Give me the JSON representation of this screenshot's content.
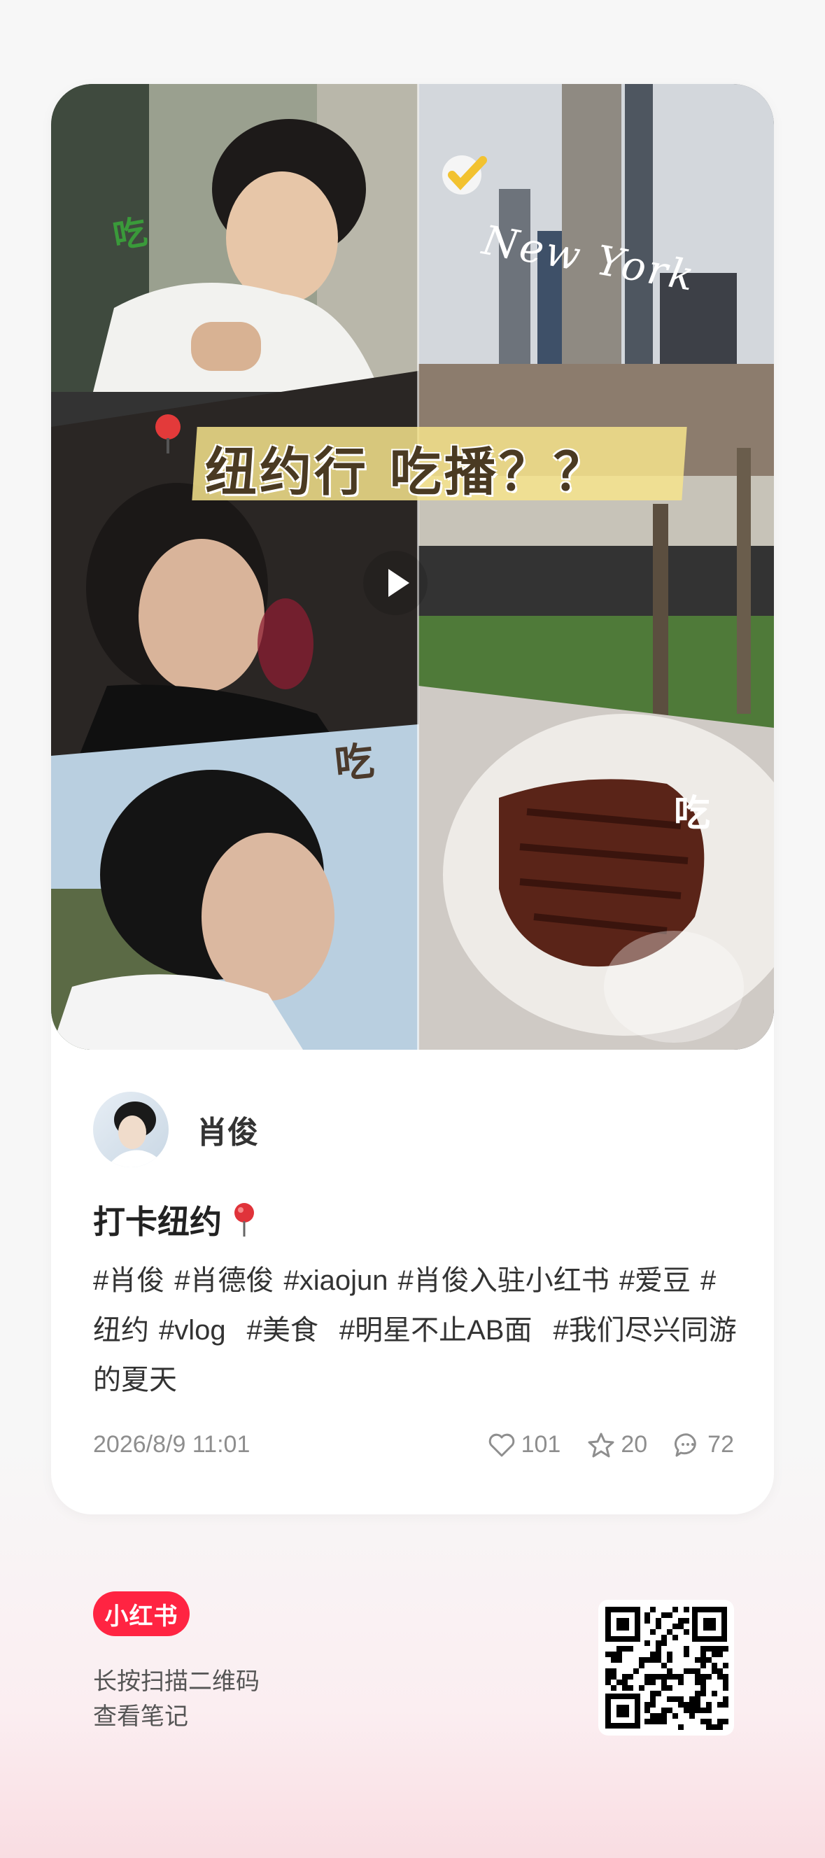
{
  "cover": {
    "title": "纽约行 吃播？？",
    "ny_label": "New York",
    "stickers": [
      "吃",
      "吃",
      "吃"
    ]
  },
  "author": {
    "name": "肖俊"
  },
  "post": {
    "title": "打卡纽约",
    "tags": [
      "#肖俊",
      "#肖德俊",
      "#xiaojun",
      "#肖俊入驻小红书",
      "#爱豆",
      "#纽约",
      "#vlog",
      "#美食",
      "#明星不止AB面",
      "#我们尽兴同游的夏天"
    ],
    "date": "2026/8/9 11:01",
    "likes": "101",
    "stars": "20",
    "comments": "72"
  },
  "footer": {
    "brand": "小红书",
    "line1": "长按扫描二维码",
    "line2": "查看笔记"
  },
  "colors": {
    "brand_red": "#ff2442",
    "banner_yellow": "#f6e48c"
  }
}
